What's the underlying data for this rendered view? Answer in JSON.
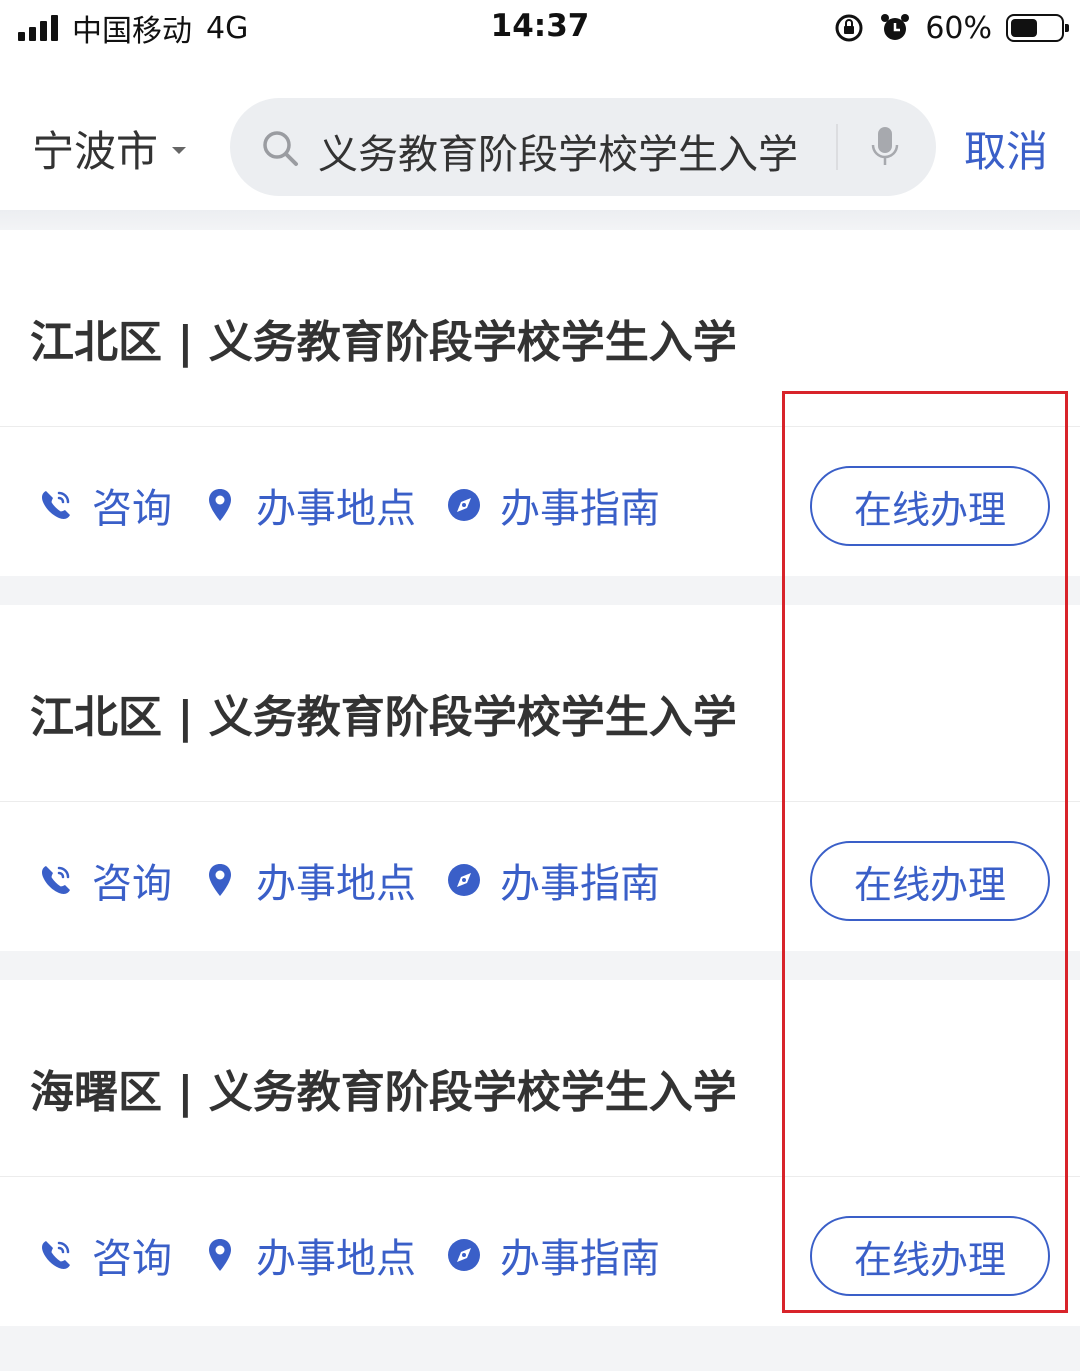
{
  "status_bar": {
    "carrier": "中国移动",
    "network": "4G",
    "time": "14:37",
    "battery": "60%",
    "battery_level": 0.6
  },
  "header": {
    "city": "宁波市",
    "search_value": "义务教育阶段学校学生入学",
    "cancel_label": "取消"
  },
  "results": [
    {
      "title": "江北区 | 义务教育阶段学校学生入学",
      "consult_label": "咨询",
      "location_label": "办事地点",
      "guide_label": "办事指南",
      "online_label": "在线办理"
    },
    {
      "title": "江北区 | 义务教育阶段学校学生入学",
      "consult_label": "咨询",
      "location_label": "办事地点",
      "guide_label": "办事指南",
      "online_label": "在线办理"
    },
    {
      "title": "海曙区 | 义务教育阶段学校学生入学",
      "consult_label": "咨询",
      "location_label": "办事地点",
      "guide_label": "办事指南",
      "online_label": "在线办理"
    }
  ],
  "colors": {
    "accent": "#3a5fc8",
    "highlight": "#d8232a"
  }
}
